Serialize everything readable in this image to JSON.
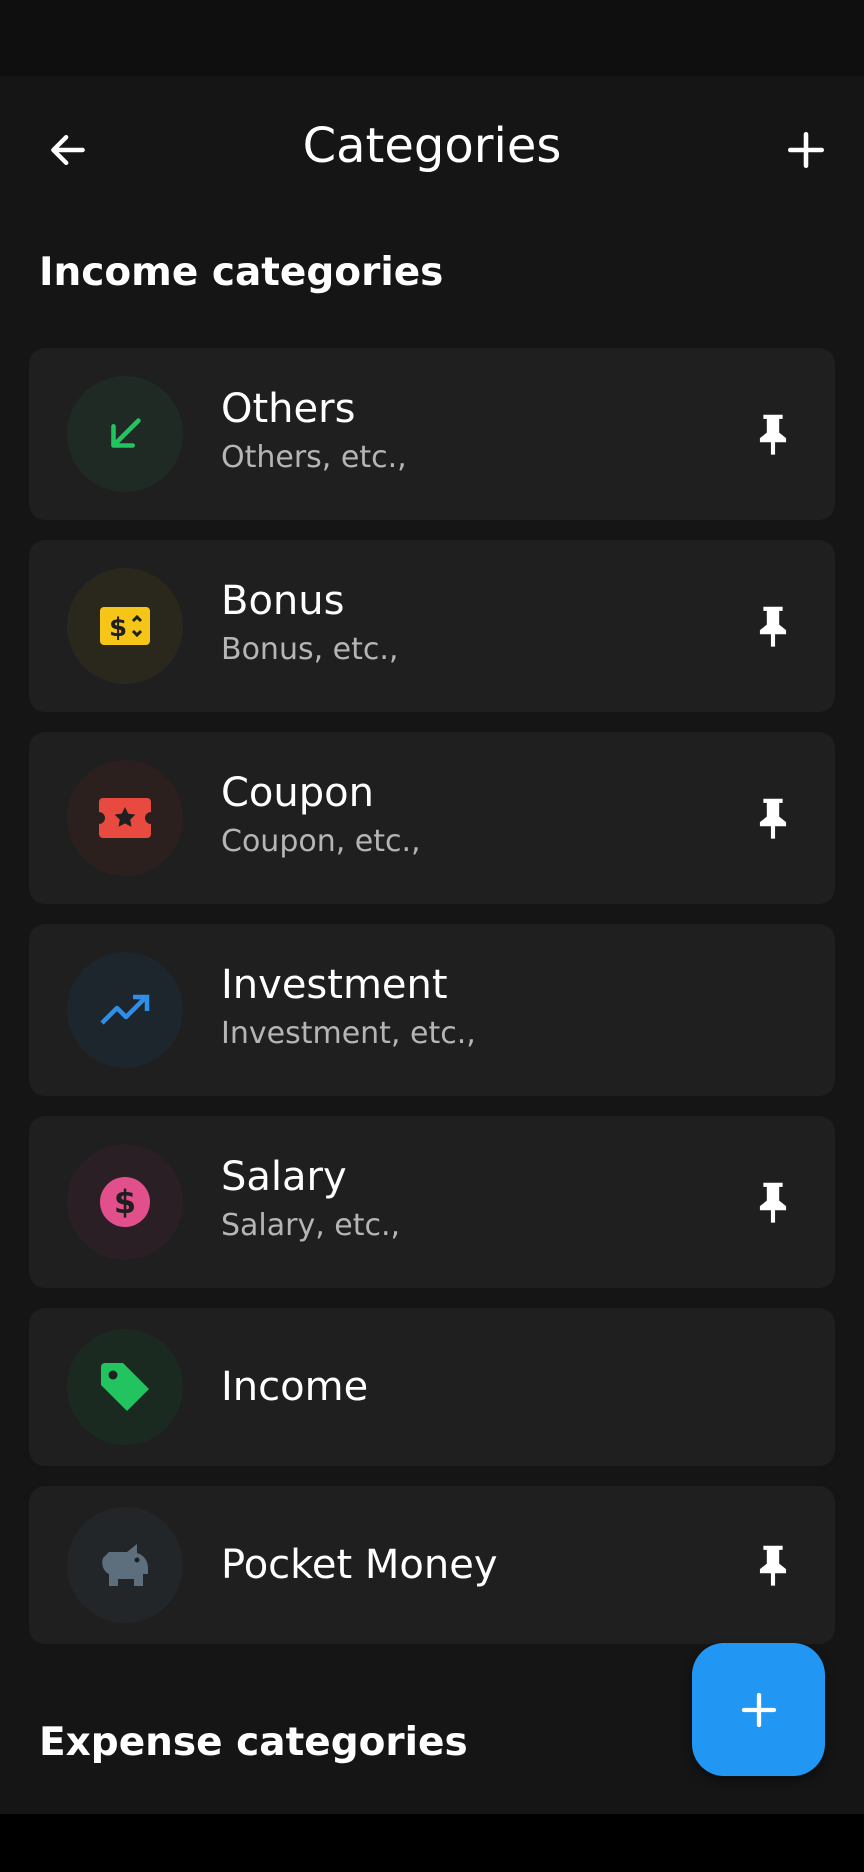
{
  "header": {
    "title": "Categories"
  },
  "sections": {
    "income_title": "Income categories",
    "expense_title": "Expense categories"
  },
  "colors": {
    "background": "#151515",
    "card": "#1f1f1f",
    "fab": "#2196f3",
    "accent_green": "#21c45e",
    "accent_yellow": "#f5c518",
    "accent_red": "#e94a3f",
    "accent_blue": "#2f8fe8",
    "accent_pink": "#e2508c",
    "accent_slate": "#5d6f7d"
  },
  "income_categories": [
    {
      "name": "Others",
      "description": "Others, etc.,",
      "icon": "arrow-down-left-icon",
      "pinned": true
    },
    {
      "name": "Bonus",
      "description": "Bonus, etc.,",
      "icon": "money-bill-icon",
      "pinned": true
    },
    {
      "name": "Coupon",
      "description": "Coupon, etc.,",
      "icon": "ticket-star-icon",
      "pinned": true
    },
    {
      "name": "Investment",
      "description": "Investment, etc.,",
      "icon": "trending-up-icon",
      "pinned": false
    },
    {
      "name": "Salary",
      "description": "Salary, etc.,",
      "icon": "dollar-circle-icon",
      "pinned": true
    },
    {
      "name": "Income",
      "description": "",
      "icon": "tag-icon",
      "pinned": false
    },
    {
      "name": "Pocket Money",
      "description": "",
      "icon": "piggy-bank-icon",
      "pinned": true
    }
  ]
}
